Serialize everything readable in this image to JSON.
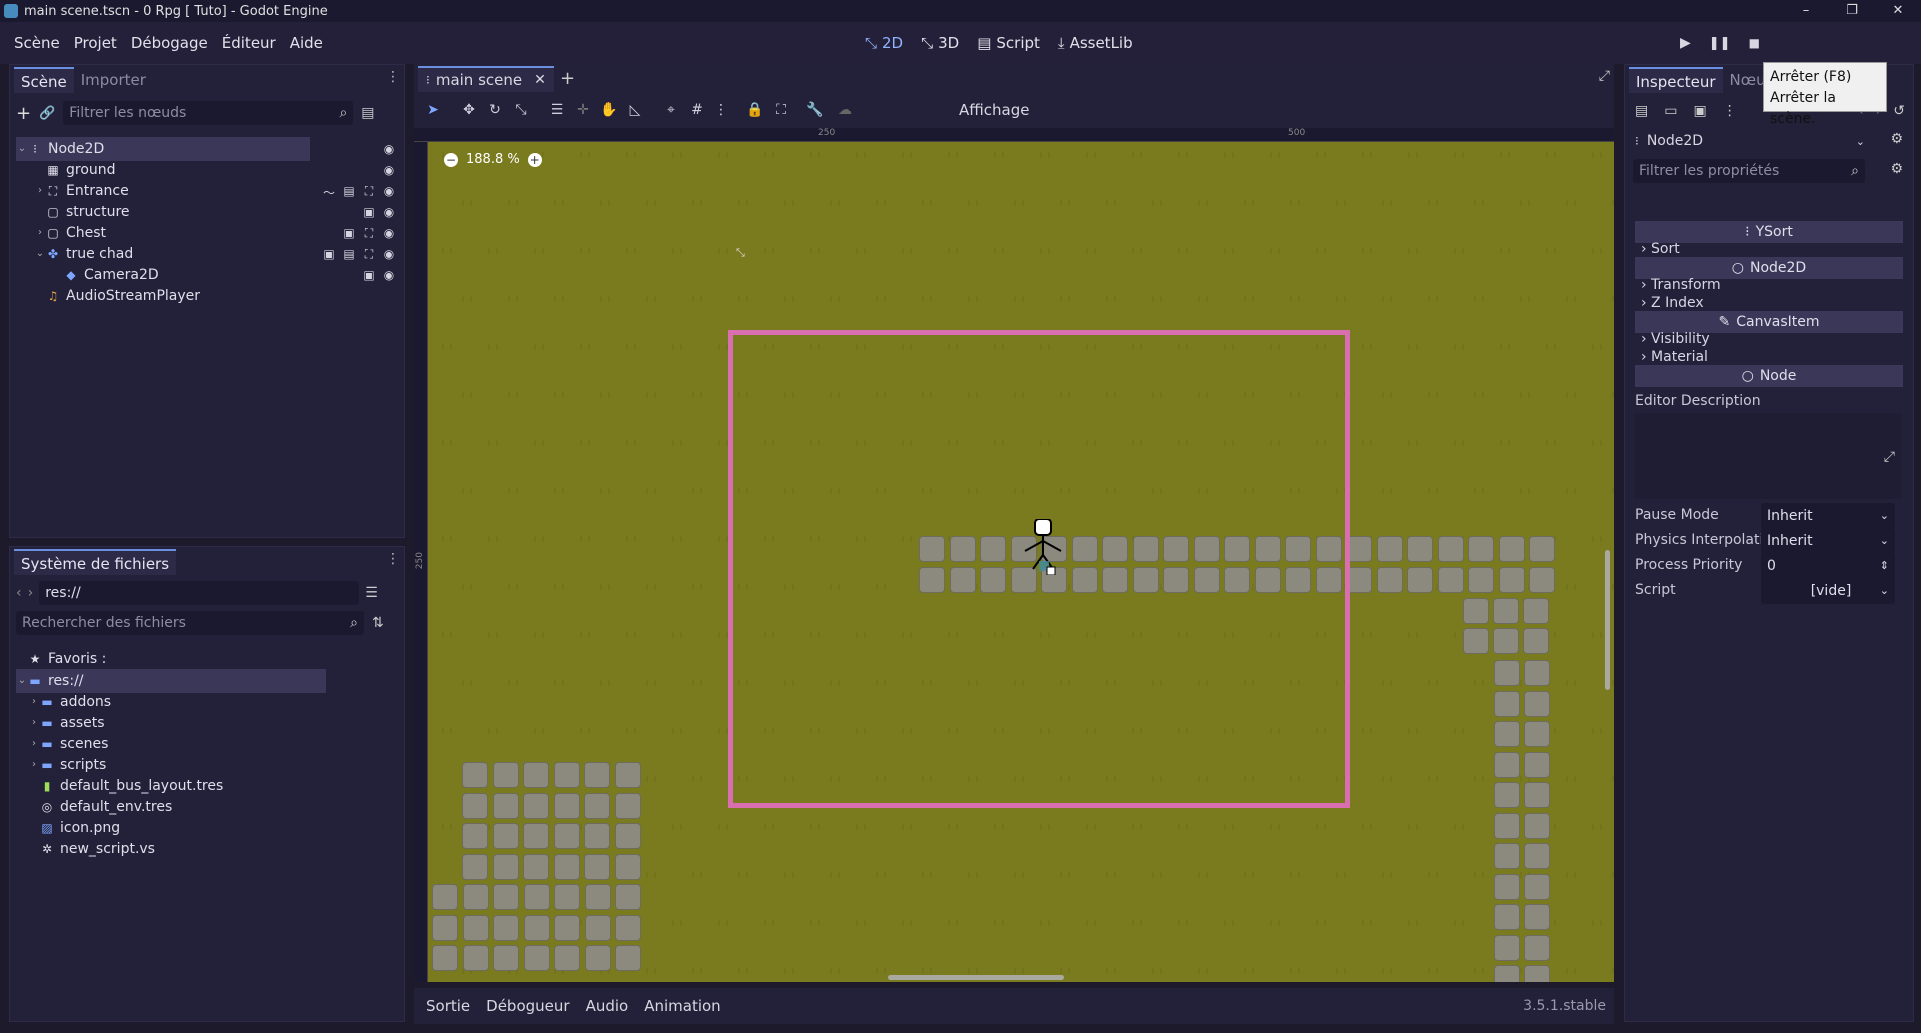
{
  "titlebar": {
    "title": "main scene.tscn - 0 Rpg [ Tuto] - Godot Engine",
    "minimize": "–",
    "maximize": "❐",
    "close": "✕"
  },
  "menu": {
    "items": [
      "Scène",
      "Projet",
      "Débogage",
      "Éditeur",
      "Aide"
    ],
    "main_screens": [
      {
        "label": "2D",
        "icon": "2d-icon"
      },
      {
        "label": "3D",
        "icon": "3d-icon"
      },
      {
        "label": "Script",
        "icon": "script-icon"
      },
      {
        "label": "AssetLib",
        "icon": "assetlib-icon"
      }
    ],
    "tooltip": [
      "Arrêter (F8)",
      "Arrêter la scène."
    ]
  },
  "scene_dock": {
    "tabs": [
      "Scène",
      "Importer"
    ],
    "filter_placeholder": "Filtrer les nœuds",
    "nodes": [
      {
        "label": "Node2D",
        "indent": 0,
        "arrow": "⌄",
        "icon": "ysort-icon",
        "badges": [],
        "visible": true,
        "selected": true
      },
      {
        "label": "ground",
        "indent": 1,
        "arrow": "",
        "icon": "tilemap-icon",
        "badges": [],
        "visible": true
      },
      {
        "label": "Entrance",
        "indent": 1,
        "arrow": "›",
        "icon": "area2d-icon",
        "badges": [
          "signal-icon",
          "script-icon",
          "group-icon"
        ],
        "visible": true
      },
      {
        "label": "structure",
        "indent": 1,
        "arrow": "",
        "icon": "staticbody-icon",
        "badges": [
          "film-icon"
        ],
        "visible": true
      },
      {
        "label": "Chest",
        "indent": 1,
        "arrow": "›",
        "icon": "staticbody-icon",
        "badges": [
          "film-icon",
          "group-icon"
        ],
        "visible": true
      },
      {
        "label": "true chad",
        "indent": 1,
        "arrow": "⌄",
        "icon": "kinematic-icon",
        "badges": [
          "film-icon",
          "script-icon",
          "group-icon"
        ],
        "visible": true
      },
      {
        "label": "Camera2D",
        "indent": 2,
        "arrow": "",
        "icon": "camera-icon",
        "badges": [
          "film-icon"
        ],
        "visible": true
      },
      {
        "label": "AudioStreamPlayer",
        "indent": 1,
        "arrow": "",
        "icon": "audio-icon",
        "badges": [],
        "visible": false
      }
    ]
  },
  "filesystem": {
    "title": "Système de fichiers",
    "path": "res://",
    "search_placeholder": "Rechercher des fichiers",
    "favorites_label": "Favoris :",
    "items": [
      {
        "label": "res://",
        "indent": 0,
        "arrow": "⌄",
        "icon": "folder-icon",
        "selected": true
      },
      {
        "label": "addons",
        "indent": 1,
        "arrow": "›",
        "icon": "folder-icon"
      },
      {
        "label": "assets",
        "indent": 1,
        "arrow": "›",
        "icon": "folder-icon"
      },
      {
        "label": "scenes",
        "indent": 1,
        "arrow": "›",
        "icon": "folder-icon"
      },
      {
        "label": "scripts",
        "indent": 1,
        "arrow": "›",
        "icon": "folder-icon"
      },
      {
        "label": "default_bus_layout.tres",
        "indent": 1,
        "arrow": "",
        "icon": "bus-icon"
      },
      {
        "label": "default_env.tres",
        "indent": 1,
        "arrow": "",
        "icon": "globe-icon"
      },
      {
        "label": "icon.png",
        "indent": 1,
        "arrow": "",
        "icon": "image-icon"
      },
      {
        "label": "new_script.vs",
        "indent": 1,
        "arrow": "",
        "icon": "gear-icon"
      }
    ]
  },
  "editor": {
    "tab_label": "main scene",
    "view_menu": "Affichage",
    "zoom": "188.8 %",
    "ruler_marks": [
      "250",
      "500"
    ],
    "ruler_v_mark": "250"
  },
  "bottom": {
    "tabs": [
      "Sortie",
      "Débogueur",
      "Audio",
      "Animation"
    ],
    "version": "3.5.1.stable"
  },
  "inspector": {
    "tabs": [
      "Inspecteur",
      "Nœud"
    ],
    "node_name": "Node2D",
    "filter_placeholder": "Filtrer les propriétés",
    "sections": [
      {
        "type": "header",
        "label": "YSort",
        "icon": "ysort-icon"
      },
      {
        "type": "group",
        "label": "Sort"
      },
      {
        "type": "header",
        "label": "Node2D",
        "icon": "circle-icon"
      },
      {
        "type": "group",
        "label": "Transform"
      },
      {
        "type": "group",
        "label": "Z Index"
      },
      {
        "type": "header",
        "label": "CanvasItem",
        "icon": "pencil-icon"
      },
      {
        "type": "group",
        "label": "Visibility"
      },
      {
        "type": "group",
        "label": "Material"
      },
      {
        "type": "header",
        "label": "Node",
        "icon": "circle-icon"
      }
    ],
    "editor_description": "Editor Description",
    "props": [
      {
        "label": "Pause Mode",
        "value": "Inherit",
        "control": "dropdown"
      },
      {
        "label": "Physics Interpolati",
        "value": "Inherit",
        "control": "dropdown"
      },
      {
        "label": "Process Priority",
        "value": "0",
        "control": "spin"
      },
      {
        "label": "Script",
        "value": "[vide]",
        "control": "dropdown"
      }
    ]
  },
  "colors": {
    "background": "#1d1a2b",
    "panel": "#232039",
    "grass": "#7a7a1e",
    "camera_rect": "#d96fb0",
    "accent": "#6a8fe0"
  }
}
